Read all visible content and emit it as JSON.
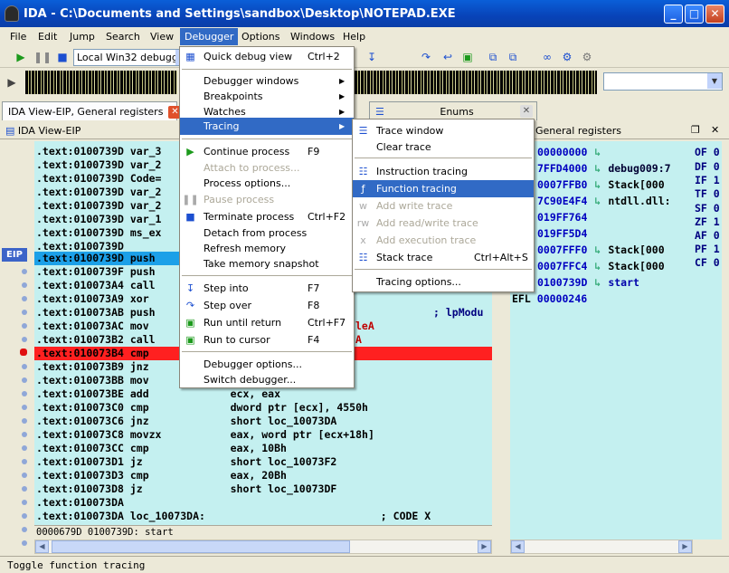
{
  "window": {
    "title": "IDA - C:\\Documents and Settings\\sandbox\\Desktop\\NOTEPAD.EXE"
  },
  "menubar": [
    "File",
    "Edit",
    "Jump",
    "Search",
    "View",
    "Debugger",
    "Options",
    "Windows",
    "Help"
  ],
  "toolbar": {
    "debugger_combo": "Local Win32 debugger"
  },
  "tabs": {
    "ida_view": "IDA View-EIP, General registers",
    "enums": "Enums"
  },
  "panes": {
    "ida_view_title": "IDA View-EIP",
    "registers_title": "General registers"
  },
  "eip_label": "EIP",
  "disasm": [
    ".text:0100739D var_3",
    ".text:0100739D var_2",
    ".text:0100739D Code=",
    ".text:0100739D var_2",
    ".text:0100739D var_2",
    ".text:0100739D var_1",
    ".text:0100739D ms_ex",
    ".text:0100739D",
    ".text:0100739D push",
    ".text:0100739F push",
    ".text:010073A4 call",
    ".text:010073A9 xor",
    ".text:010073AB push",
    ".text:010073AC mov",
    ".text:010073B2 call",
    ".text:010073B4 cmp",
    ".text:010073B9 jnz",
    ".text:010073BB mov",
    ".text:010073BE add             ecx, eax",
    ".text:010073C0 cmp             dword ptr [ecx], 4550h",
    ".text:010073C6 jnz             short loc_10073DA",
    ".text:010073C8 movzx           eax, word ptr [ecx+18h]",
    ".text:010073CC cmp             eax, 10Bh",
    ".text:010073D1 jz              short loc_10073F2",
    ".text:010073D3 cmp             eax, 20Bh",
    ".text:010073D8 jz              short loc_10073DF",
    ".text:010073DA",
    ".text:010073DA loc_10073DA:                            ; CODE X"
  ],
  "disasm_tail_texts": {
    "lpmodu": "; lpModu",
    "lea": "leA",
    "a": "A"
  },
  "disasm_status": "0000679D 0100739D: start",
  "registers": [
    {
      "v": "00000000",
      "t": ""
    },
    {
      "v": "7FFD4000",
      "t": "debug009:7"
    },
    {
      "v": "0007FFB0",
      "t": "Stack[000"
    },
    {
      "v": "7C90E4F4",
      "t": "ntdll.dll:"
    },
    {
      "v": "019FF764",
      "t": ""
    },
    {
      "v": "019FF5D4",
      "t": ""
    },
    {
      "v": "0007FFF0",
      "t": "Stack[000"
    },
    {
      "v": "0007FFC4",
      "t": "Stack[000"
    },
    {
      "v": "0100739D",
      "t": "start"
    }
  ],
  "efl": {
    "name": "EFL",
    "value": "00000246"
  },
  "flags": [
    "OF 0",
    "DF 0",
    "IF 1",
    "TF 0",
    "SF 0",
    "ZF 1",
    "AF 0",
    "PF 1",
    "CF 0"
  ],
  "debugger_menu": {
    "quick_debug_view": "Quick debug view",
    "quick_debug_view_sc": "Ctrl+2",
    "debugger_windows": "Debugger windows",
    "breakpoints": "Breakpoints",
    "watches": "Watches",
    "tracing": "Tracing",
    "continue_process": "Continue process",
    "continue_sc": "F9",
    "attach": "Attach to process...",
    "process_options": "Process options...",
    "pause": "Pause process",
    "terminate": "Terminate process",
    "terminate_sc": "Ctrl+F2",
    "detach": "Detach from process",
    "refresh_memory": "Refresh memory",
    "take_snapshot": "Take memory snapshot",
    "step_into": "Step into",
    "step_into_sc": "F7",
    "step_over": "Step over",
    "step_over_sc": "F8",
    "run_until_return": "Run until return",
    "run_until_return_sc": "Ctrl+F7",
    "run_to_cursor": "Run to cursor",
    "run_to_cursor_sc": "F4",
    "debugger_options": "Debugger options...",
    "switch_debugger": "Switch debugger..."
  },
  "tracing_menu": {
    "trace_window": "Trace window",
    "clear_trace": "Clear trace",
    "instruction_tracing": "Instruction tracing",
    "function_tracing": "Function tracing",
    "add_write_trace": "Add write trace",
    "add_rw_trace": "Add read/write trace",
    "add_exec_trace": "Add execution trace",
    "stack_trace": "Stack trace",
    "stack_trace_sc": "Ctrl+Alt+S",
    "tracing_options": "Tracing options..."
  },
  "status_bar": "Toggle function tracing",
  "colors": {
    "highlight": "#316ac5",
    "disasm_bg": "#c4f0f0",
    "eip_row": "#1ca0e8",
    "breakpoint_row": "#ff2020"
  }
}
